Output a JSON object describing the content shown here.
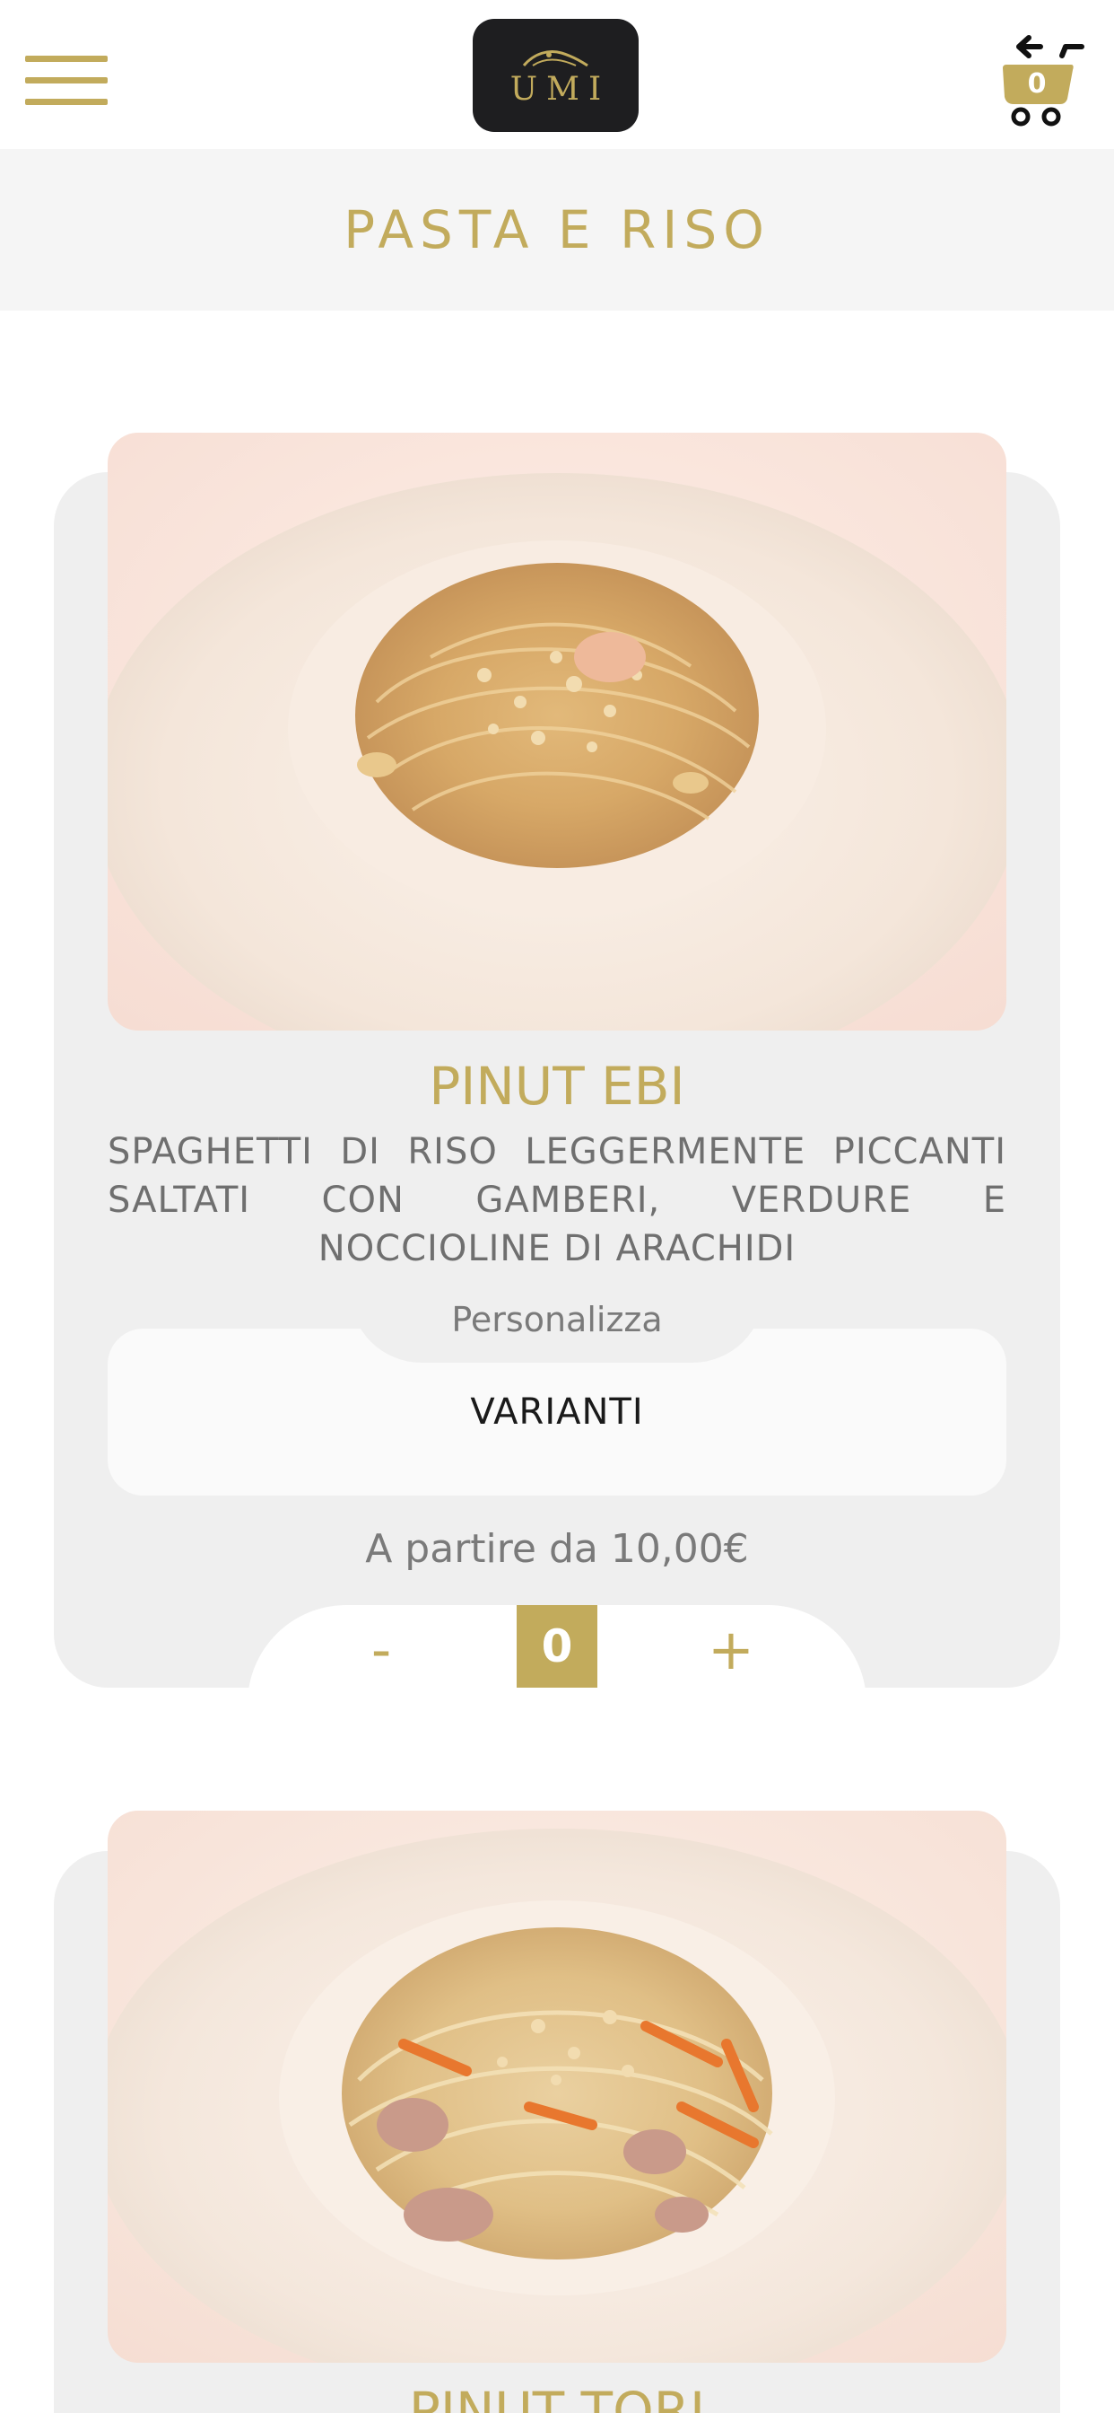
{
  "header": {
    "menu_icon": "hamburger-menu-icon",
    "logo_text": "UMI",
    "cart_icon": "cart-back-icon",
    "cart_count": "0"
  },
  "section": {
    "title": "PASTA E RISO"
  },
  "products": [
    {
      "name": "PINUT EBI",
      "description": "SPAGHETTI DI RISO LEGGERMENTE PICCANTI SALTATI CON GAMBERI, VERDURE E NOCCIOLINE DI ARACHIDI",
      "personalize_label": "Personalizza",
      "variants_label": "VARIANTI",
      "price_text": "A partire da 10,00€",
      "qty_minus": "-",
      "qty_plus": "+",
      "qty": "0"
    },
    {
      "name": "PINUT TORI"
    }
  ],
  "colors": {
    "accent": "#c2ab5c",
    "card_bg": "#efefef",
    "band_bg": "#f5f5f5",
    "logo_bg": "#1e1e20"
  }
}
